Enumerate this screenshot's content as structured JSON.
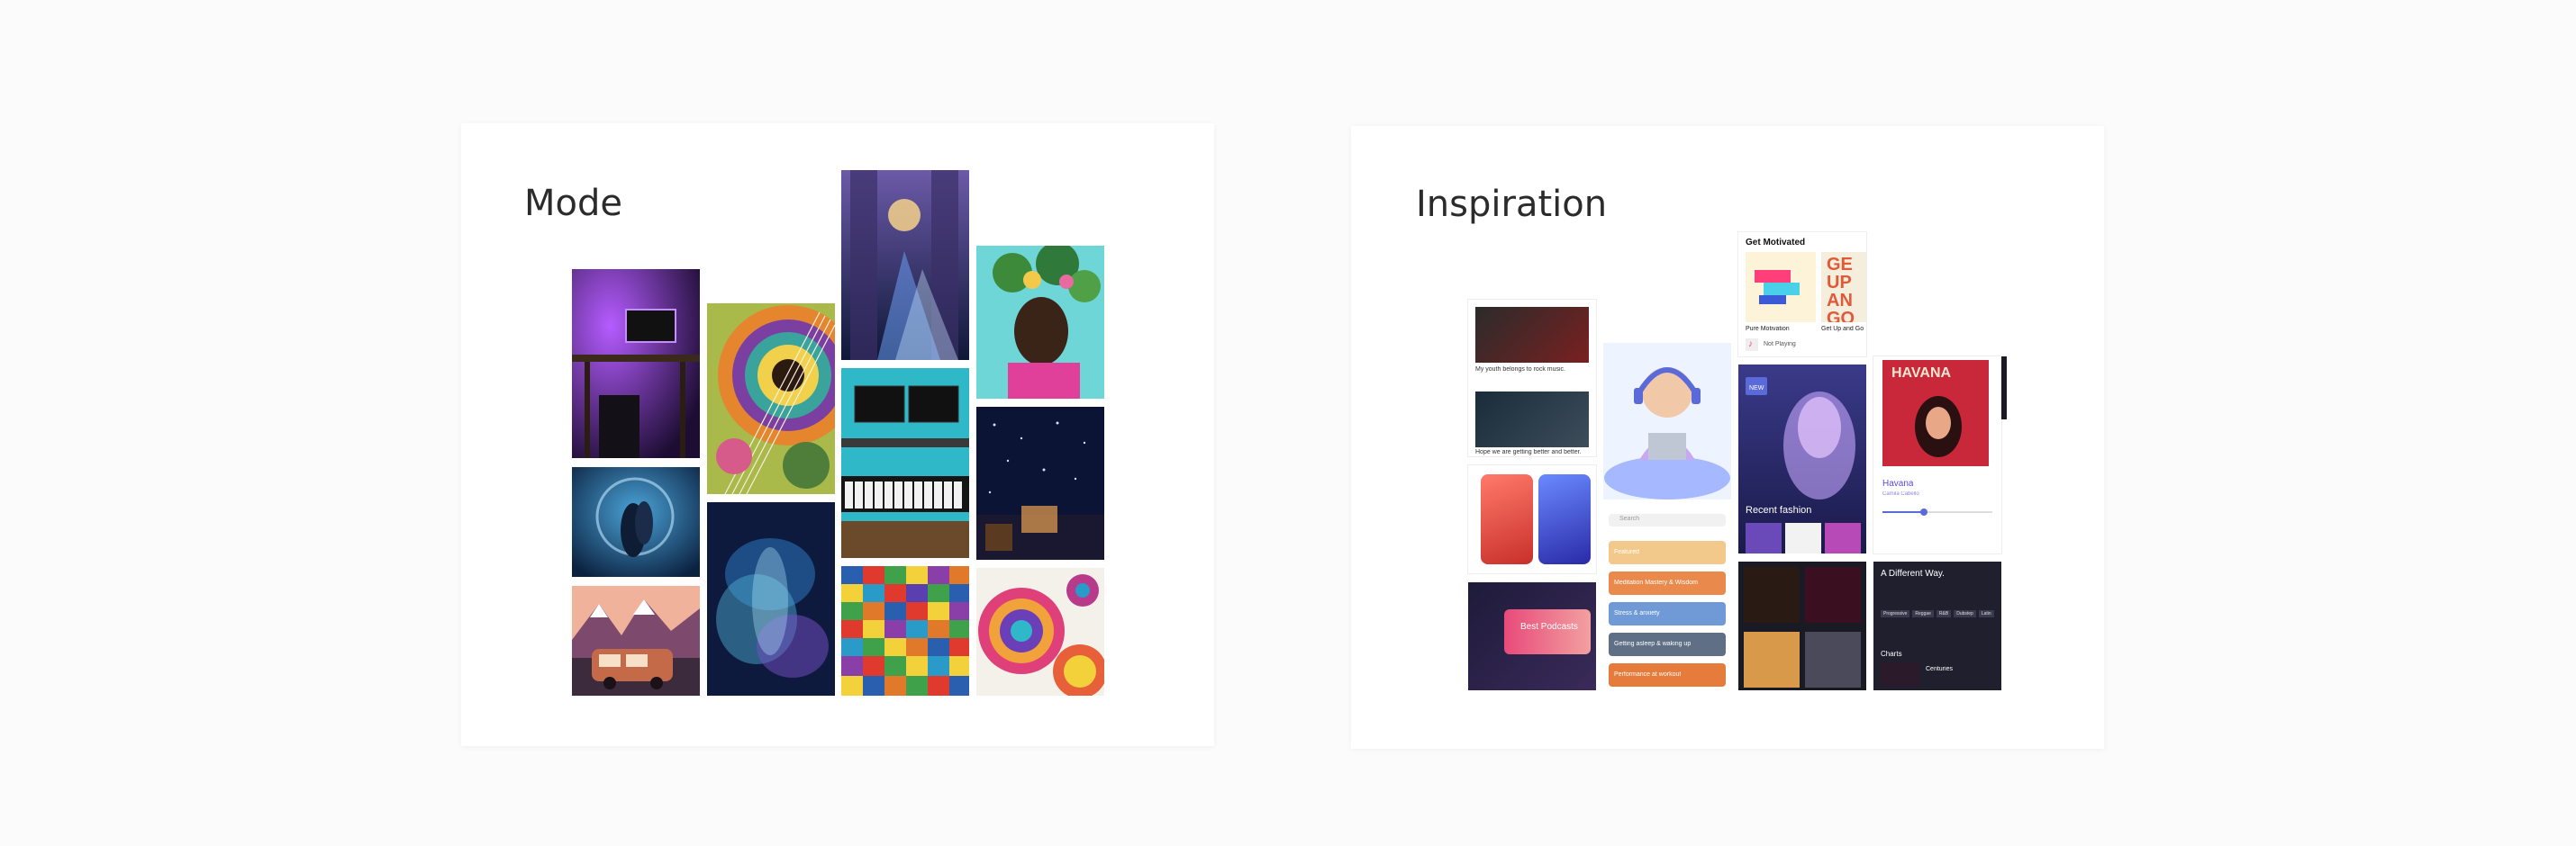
{
  "mode": {
    "title": "Mode",
    "images": [
      "purple-desk-studio",
      "guitar-mandala-art",
      "city-night-lights",
      "flower-crown-portrait",
      "moonlit-couple-art",
      "blue-smoke-texture",
      "keyboard-studio-setup",
      "starry-room",
      "van-mountain-illustration",
      "colorful-pixel-mosaic",
      "psychedelic-floral-pattern"
    ]
  },
  "inspiration": {
    "title": "Inspiration",
    "feed": {
      "post1": "My youth belongs to rock music.",
      "post2": "Hope we are getting better and better."
    },
    "get_motivated": {
      "title": "Get Motivated",
      "item1": "Pure Motivation",
      "item2": "Get Up and Go",
      "art_text": "GE UP AN GO",
      "now_playing": "Not Playing"
    },
    "search": {
      "placeholder": "Search"
    },
    "categories": [
      {
        "label": "Featured",
        "color": "#f3c98b"
      },
      {
        "label": "Meditation Mastery & Wisdom",
        "color": "#e98a4c"
      },
      {
        "label": "Stress & anxiety",
        "color": "#6f9ad6"
      },
      {
        "label": "Getting asleep & waking up",
        "color": "#5f6f85"
      },
      {
        "label": "Performance at workout",
        "color": "#e57c3c"
      }
    ],
    "fashion": {
      "badge": "NEW",
      "title": "Recent fashion"
    },
    "havana": {
      "cover_title": "HAVANA",
      "song": "Havana",
      "artist": "Camila Cabello"
    },
    "podcasts": {
      "title": "Best Podcasts"
    },
    "different_way": {
      "title": "A Different Way.",
      "chips": [
        "Progressive",
        "Reggae",
        "R&B",
        "Dubstep",
        "Latin"
      ],
      "charts": "Charts",
      "chart_item": "Centuries"
    }
  },
  "colors": {
    "text_dark": "#2b2b2b",
    "card_bg": "#ffffff",
    "page_bg": "#fbfbfb"
  }
}
